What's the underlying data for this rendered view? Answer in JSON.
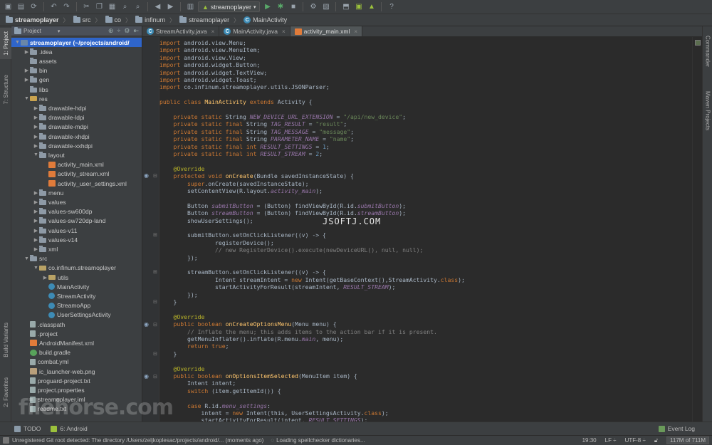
{
  "toolbar": {
    "run_config": "streamoplayer",
    "icons": [
      "project-icon",
      "save-icon",
      "sync-icon",
      "undo-icon",
      "redo-icon",
      "cut-icon",
      "copy-icon",
      "paste-icon",
      "find-icon",
      "replace-icon",
      "back-icon",
      "forward-icon",
      "make-icon",
      "run-config-icon",
      "run-icon",
      "debug-icon",
      "stop-icon",
      "sdk-manager-icon",
      "avd-manager-icon",
      "android-icon",
      "help-icon"
    ]
  },
  "breadcrumb": [
    "streamoplayer",
    "src",
    "co",
    "infinum",
    "streamoplayer",
    "MainActivity"
  ],
  "left_stripe": {
    "project": "1: Project",
    "structure": "7: Structure",
    "build_variants": "Build Variants",
    "favorites": "2: Favorites"
  },
  "project_panel": {
    "title": "Project",
    "tree": [
      {
        "label": "streamoplayer (~/projects/android/",
        "depth": 0,
        "icon": "module",
        "arrow": "down",
        "selected": true
      },
      {
        "label": ".idea",
        "depth": 1,
        "icon": "folder",
        "arrow": "right"
      },
      {
        "label": "assets",
        "depth": 1,
        "icon": "folder",
        "arrow": ""
      },
      {
        "label": "bin",
        "depth": 1,
        "icon": "folder",
        "arrow": "right"
      },
      {
        "label": "gen",
        "depth": 1,
        "icon": "folder",
        "arrow": "right"
      },
      {
        "label": "libs",
        "depth": 1,
        "icon": "folder",
        "arrow": ""
      },
      {
        "label": "res",
        "depth": 1,
        "icon": "res",
        "arrow": "down"
      },
      {
        "label": "drawable-hdpi",
        "depth": 2,
        "icon": "folder",
        "arrow": "right"
      },
      {
        "label": "drawable-ldpi",
        "depth": 2,
        "icon": "folder",
        "arrow": "right"
      },
      {
        "label": "drawable-mdpi",
        "depth": 2,
        "icon": "folder",
        "arrow": "right"
      },
      {
        "label": "drawable-xhdpi",
        "depth": 2,
        "icon": "folder",
        "arrow": "right"
      },
      {
        "label": "drawable-xxhdpi",
        "depth": 2,
        "icon": "folder",
        "arrow": "right"
      },
      {
        "label": "layout",
        "depth": 2,
        "icon": "folder",
        "arrow": "down"
      },
      {
        "label": "activity_main.xml",
        "depth": 3,
        "icon": "xml",
        "arrow": ""
      },
      {
        "label": "activity_stream.xml",
        "depth": 3,
        "icon": "xml",
        "arrow": ""
      },
      {
        "label": "activity_user_settings.xml",
        "depth": 3,
        "icon": "xml",
        "arrow": ""
      },
      {
        "label": "menu",
        "depth": 2,
        "icon": "folder",
        "arrow": "right"
      },
      {
        "label": "values",
        "depth": 2,
        "icon": "folder",
        "arrow": "right"
      },
      {
        "label": "values-sw600dp",
        "depth": 2,
        "icon": "folder",
        "arrow": "right"
      },
      {
        "label": "values-sw720dp-land",
        "depth": 2,
        "icon": "folder",
        "arrow": "right"
      },
      {
        "label": "values-v11",
        "depth": 2,
        "icon": "folder",
        "arrow": "right"
      },
      {
        "label": "values-v14",
        "depth": 2,
        "icon": "folder",
        "arrow": "right"
      },
      {
        "label": "xml",
        "depth": 2,
        "icon": "folder",
        "arrow": "right"
      },
      {
        "label": "src",
        "depth": 1,
        "icon": "folder",
        "arrow": "down"
      },
      {
        "label": "co.infinum.streamoplayer",
        "depth": 2,
        "icon": "package",
        "arrow": "down"
      },
      {
        "label": "utils",
        "depth": 3,
        "icon": "package",
        "arrow": "right"
      },
      {
        "label": "MainActivity",
        "depth": 3,
        "icon": "class",
        "arrow": ""
      },
      {
        "label": "StreamActivity",
        "depth": 3,
        "icon": "class",
        "arrow": ""
      },
      {
        "label": "StreamoApp",
        "depth": 3,
        "icon": "class",
        "arrow": ""
      },
      {
        "label": "UserSettingsActivity",
        "depth": 3,
        "icon": "class",
        "arrow": ""
      },
      {
        "label": ".classpath",
        "depth": 1,
        "icon": "file",
        "arrow": ""
      },
      {
        "label": ".project",
        "depth": 1,
        "icon": "file",
        "arrow": ""
      },
      {
        "label": "AndroidManifest.xml",
        "depth": 1,
        "icon": "xml",
        "arrow": ""
      },
      {
        "label": "build.gradle",
        "depth": 1,
        "icon": "gradle",
        "arrow": ""
      },
      {
        "label": "combat.yml",
        "depth": 1,
        "icon": "file",
        "arrow": ""
      },
      {
        "label": "ic_launcher-web.png",
        "depth": 1,
        "icon": "image",
        "arrow": ""
      },
      {
        "label": "proguard-project.txt",
        "depth": 1,
        "icon": "file",
        "arrow": ""
      },
      {
        "label": "project.properties",
        "depth": 1,
        "icon": "file",
        "arrow": ""
      },
      {
        "label": "streamoplayer.iml",
        "depth": 1,
        "icon": "file",
        "arrow": ""
      },
      {
        "label": "readme.txt",
        "depth": 1,
        "icon": "file",
        "arrow": ""
      }
    ]
  },
  "editor": {
    "tabs": [
      {
        "label": "StreamActivity.java",
        "active": false
      },
      {
        "label": "MainActivity.java",
        "active": false
      },
      {
        "label": "activity_main.xml",
        "active": true
      }
    ],
    "code_lines": [
      "import android.view.Menu;",
      "import android.view.MenuItem;",
      "import android.view.View;",
      "import android.widget.Button;",
      "import android.widget.TextView;",
      "import android.widget.Toast;",
      "import co.infinum.streamoplayer.utils.JSONParser;",
      "",
      "public class MainActivity extends Activity {",
      "",
      "    private static String NEW_DEVICE_URL_EXTENSION = \"/api/new_device\";",
      "    private static final String TAG_RESULT = \"result\";",
      "    private static final String TAG_MESSAGE = \"message\";",
      "    private static final String PARAMETER_NAME = \"name\";",
      "    private static final int RESULT_SETTINGS = 1;",
      "    private static final int RESULT_STREAM = 2;",
      "",
      "    @Override",
      "    protected void onCreate(Bundle savedInstanceState) {",
      "        super.onCreate(savedInstanceState);",
      "        setContentView(R.layout.activity_main);",
      "",
      "        Button submitButton = (Button) findViewById(R.id.submitButton);",
      "        Button streamButton = (Button) findViewById(R.id.streamButton);",
      "        showUserSettings();",
      "",
      "        submitButton.setOnClickListener((v) -> {",
      "                registerDevice();",
      "                // new RegisterDevice().execute(newDeviceURL(), null, null);",
      "        });",
      "",
      "        streamButton.setOnClickListener((v) -> {",
      "                Intent streamIntent = new Intent(getBaseContext(),StreamActivity.class);",
      "                startActivityForResult(streamIntent, RESULT_STREAM);",
      "        });",
      "    }",
      "",
      "    @Override",
      "    public boolean onCreateOptionsMenu(Menu menu) {",
      "        // Inflate the menu; this adds items to the action bar if it is present.",
      "        getMenuInflater().inflate(R.menu.main, menu);",
      "        return true;",
      "    }",
      "",
      "    @Override",
      "    public boolean onOptionsItemSelected(MenuItem item) {",
      "        Intent intent;",
      "        switch (item.getItemId()) {",
      "",
      "        case R.id.menu_settings:",
      "            intent = new Intent(this, UserSettingsActivity.class);",
      "            startActivityForResult(intent, RESULT_SETTINGS);"
    ],
    "overlay_text": "JSOFTJ.COM"
  },
  "right_stripe": {
    "commander": "Commander",
    "maven": "Maven Projects"
  },
  "bottom_tools": {
    "todo": "TODO",
    "android": "6: Android",
    "event_log": "Event Log"
  },
  "status_bar": {
    "message": "Unregistered Git root detected: The directory /Users/zeljkoplesac/projects/android/... (moments ago)",
    "task": "Loading spellchecker dictionaries...",
    "position": "19:30",
    "line_sep": "LF ÷",
    "encoding": "UTF-8 ÷",
    "memory": "117M of 711M"
  },
  "brand_overlay": "filehorse.com",
  "colors": {
    "background": "#2b2b2b",
    "panel": "#3c3f41",
    "selection": "#2f65ca",
    "keyword": "#cc7832",
    "string": "#6a8759",
    "field": "#9876aa",
    "annotation": "#bbb529"
  }
}
